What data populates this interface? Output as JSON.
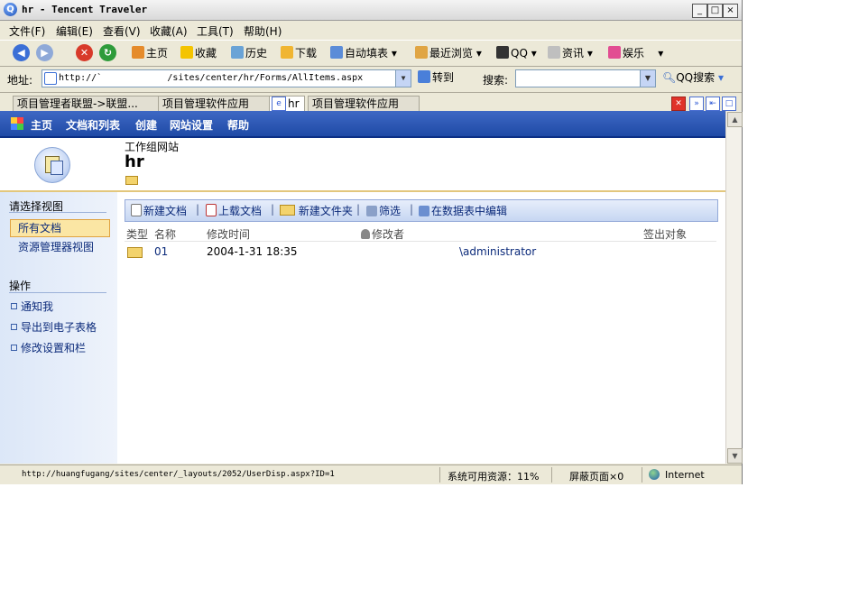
{
  "window": {
    "title": "hr - Tencent Traveler",
    "min": "_",
    "max": "□",
    "close": "×"
  },
  "menu": [
    "文件(F)",
    "编辑(E)",
    "查看(V)",
    "收藏(A)",
    "工具(T)",
    "帮助(H)"
  ],
  "toolbar": {
    "home": "主页",
    "favorites": "收藏",
    "history": "历史",
    "download": "下载",
    "autofill": "自动填表",
    "recent": "最近浏览",
    "qq": "QQ",
    "info": "资讯",
    "ent": "娱乐"
  },
  "address": {
    "label": "地址:",
    "url": "http://`            /sites/center/hr/Forms/AllItems.aspx",
    "go": "转到",
    "search_label": "搜索:",
    "qq_search": "QQ搜索"
  },
  "tabs": [
    "项目管理者联盟->联盟...",
    "项目管理软件应用",
    "hr",
    "项目管理软件应用"
  ],
  "sp": {
    "nav": [
      "主页",
      "文档和列表",
      "创建",
      "网站设置",
      "帮助"
    ],
    "site_name": "工作组网站",
    "page_title": "hr",
    "view_header": "请选择视图",
    "views": [
      "所有文档",
      "资源管理器视图"
    ],
    "actions_header": "操作",
    "actions": [
      "通知我",
      "导出到电子表格",
      "修改设置和栏"
    ],
    "toolbar": [
      "新建文档",
      "上载文档",
      "新建文件夹",
      "筛选",
      "在数据表中编辑"
    ],
    "columns": [
      "类型",
      "名称",
      "修改时间",
      "修改者",
      "签出对象"
    ],
    "rows": [
      {
        "name": "01",
        "modified": "2004-1-31 18:35",
        "modified_by": "\\administrator"
      }
    ]
  },
  "status": {
    "url": "http://huangfugang/sites/center/_layouts/2052/UserDisp.aspx?ID=1",
    "resources": "系统可用资源：11%",
    "blocked": "屏蔽页面×0",
    "zone": "Internet"
  }
}
